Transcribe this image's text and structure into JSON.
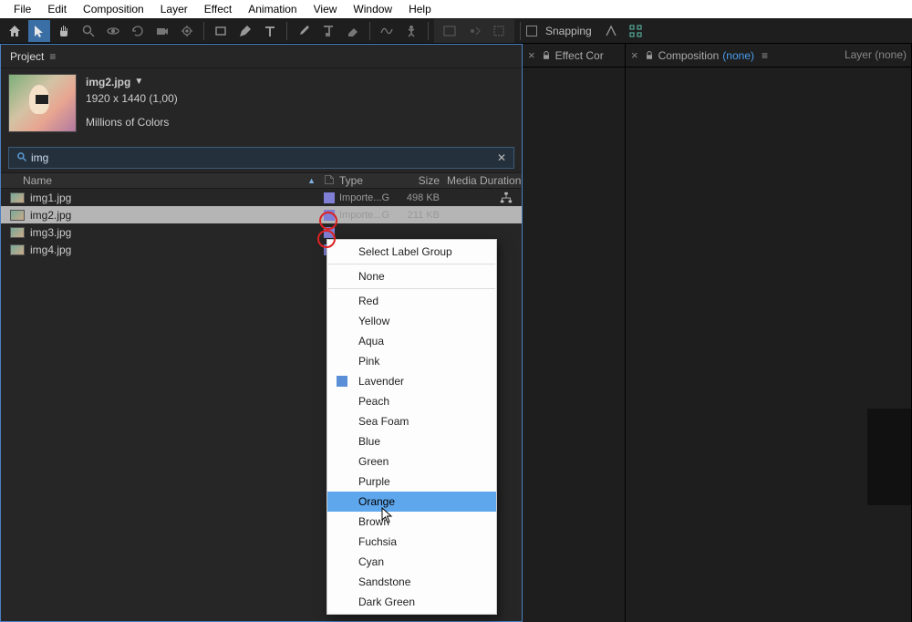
{
  "menu": {
    "items": [
      "File",
      "Edit",
      "Composition",
      "Layer",
      "Effect",
      "Animation",
      "View",
      "Window",
      "Help"
    ]
  },
  "toolbar": {
    "snapping_label": "Snapping"
  },
  "project": {
    "tab_label": "Project",
    "asset": {
      "name": "img2.jpg",
      "dimensions": "1920 x 1440 (1,00)",
      "colors": "Millions of Colors"
    },
    "search_value": "img",
    "headers": {
      "name": "Name",
      "type": "Type",
      "size": "Size",
      "media": "Media Duration"
    },
    "rows": [
      {
        "name": "img1.jpg",
        "type": "Importe...G",
        "size": "498 KB",
        "selected": false,
        "show_tree": true
      },
      {
        "name": "img2.jpg",
        "type": "Importe...G",
        "size": "211 KB",
        "selected": true,
        "show_tree": false
      },
      {
        "name": "img3.jpg",
        "type": "",
        "size": "",
        "selected": false,
        "show_tree": false
      },
      {
        "name": "img4.jpg",
        "type": "",
        "size": "",
        "selected": false,
        "show_tree": false
      }
    ]
  },
  "panels": {
    "effect_tab": "Effect Cor",
    "comp_tab": "Composition",
    "comp_none": "(none)",
    "layer_tab": "Layer (none)"
  },
  "context_menu": {
    "title": "Select Label Group",
    "none": "None",
    "items": [
      "Red",
      "Yellow",
      "Aqua",
      "Pink",
      "Lavender",
      "Peach",
      "Sea Foam",
      "Blue",
      "Green",
      "Purple",
      "Orange",
      "Brown",
      "Fuchsia",
      "Cyan",
      "Sandstone",
      "Dark Green"
    ],
    "current": "Lavender",
    "hovered": "Orange"
  }
}
